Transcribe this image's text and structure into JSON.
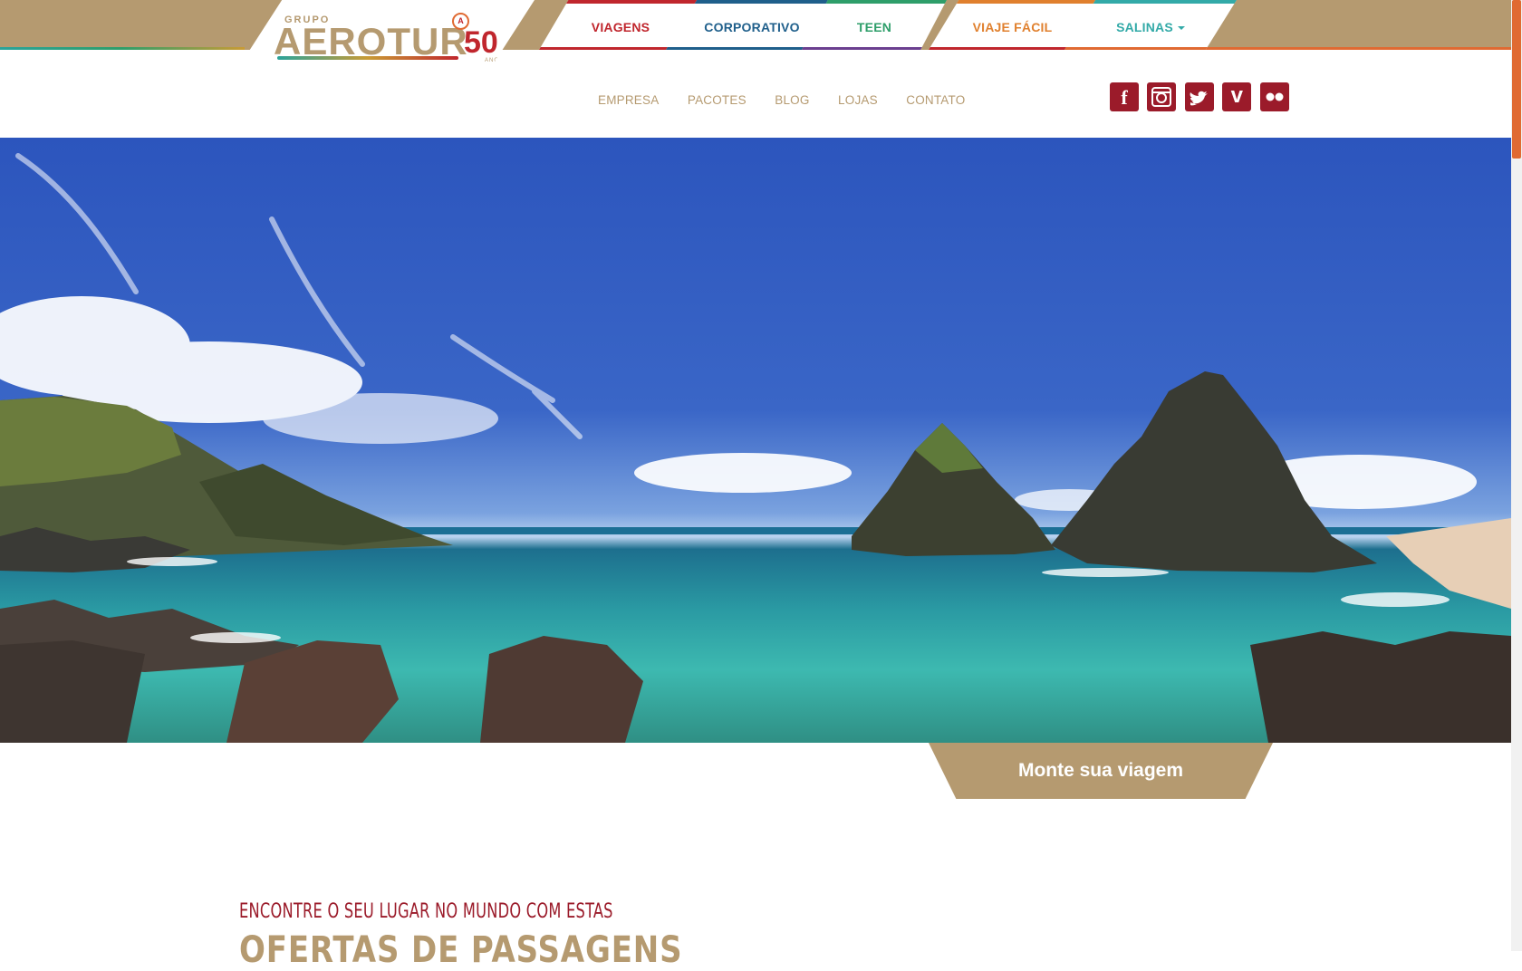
{
  "brand": {
    "grupo": "GRUPO",
    "name": "AEROTUR",
    "anniversary": "50",
    "anos": "ANOS",
    "badge": "A"
  },
  "tabs": [
    {
      "label": "VIAGENS",
      "color": "#c0262d"
    },
    {
      "label": "CORPORATIVO",
      "color": "#1f5f8b"
    },
    {
      "label": "TEEN",
      "color": "#2e9e6a"
    },
    {
      "label": "VIAJE FÁCIL",
      "color": "#e0802e"
    },
    {
      "label": "SALINAS",
      "color": "#33aaa8",
      "has_dropdown": true
    }
  ],
  "subnav": [
    "EMPRESA",
    "PACOTES",
    "BLOG",
    "LOJAS",
    "CONTATO"
  ],
  "social": [
    {
      "icon": "facebook-icon",
      "glyph": "f"
    },
    {
      "icon": "instagram-icon",
      "glyph": ""
    },
    {
      "icon": "twitter-icon",
      "glyph": ""
    },
    {
      "icon": "vimeo-icon",
      "glyph": "v"
    },
    {
      "icon": "flickr-icon",
      "glyph": ""
    }
  ],
  "hero": {
    "alt": "Morro Dois Irmãos, Fernando de Noronha"
  },
  "cta": {
    "label": "Monte sua viagem"
  },
  "section": {
    "kicker": "ENCONTRE O SEU LUGAR NO MUNDO COM ESTAS",
    "title": "OFERTAS DE PASSAGENS"
  },
  "colors": {
    "brand_gold": "#b59a70",
    "brand_red": "#9b1b2a",
    "accent_orange": "#e06a32"
  }
}
